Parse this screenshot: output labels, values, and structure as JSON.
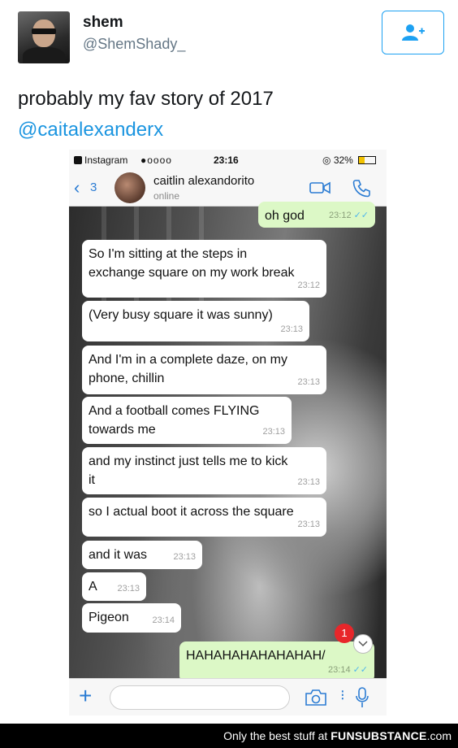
{
  "tweet": {
    "display_name": "shem",
    "handle": "@ShemShady_",
    "text": "probably my fav story of 2017",
    "mention": "@caitalexanderx"
  },
  "phone": {
    "status": {
      "carrier": "Instagram",
      "signal": "●oooo",
      "time": "23:16",
      "battery": "32%"
    },
    "header": {
      "back_count": "3",
      "contact_name": "caitlin alexandorito",
      "contact_status": "online"
    },
    "messages": [
      {
        "text": "oh god",
        "time": "23:12",
        "direction": "out"
      },
      {
        "text": "So I'm sitting at the steps in",
        "text2": "exchange square on my work break",
        "time": "23:12",
        "direction": "in"
      },
      {
        "text": "(Very busy square it was sunny)",
        "time": "23:13",
        "direction": "in"
      },
      {
        "text": "And I'm in a complete daze, on my",
        "text2": "phone, chillin",
        "time": "23:13",
        "direction": "in"
      },
      {
        "text": "And a football comes FLYING",
        "text2": "towards me",
        "time": "23:13",
        "direction": "in"
      },
      {
        "text": "and my instinct just tells me to kick",
        "text2": "it",
        "time": "23:13",
        "direction": "in"
      },
      {
        "text": "so I actual boot it across the square",
        "time": "23:13",
        "direction": "in"
      },
      {
        "text": "and it was",
        "time": "23:13",
        "direction": "in"
      },
      {
        "text": "A",
        "time": "23:13",
        "direction": "in"
      },
      {
        "text": "Pigeon",
        "time": "23:14",
        "direction": "in"
      },
      {
        "text": "HAHAHAHAHAHAHAH/",
        "time": "23:14",
        "direction": "out"
      }
    ],
    "unread_badge": "1"
  },
  "icons": [
    "add-user-icon",
    "back-chevron-icon",
    "video-call-icon",
    "phone-call-icon",
    "plus-icon",
    "camera-icon",
    "microphone-icon",
    "chevron-down-icon"
  ],
  "colors": {
    "twitter_blue": "#1da1f2",
    "mention_blue": "#1b95e0",
    "outgoing_bubble": "#dcf8c6",
    "badge_red": "#e8262a"
  },
  "footer": {
    "prefix": "Only the best stuff at",
    "brand": "FUNSUBSTANCE",
    "suffix": ".com"
  }
}
